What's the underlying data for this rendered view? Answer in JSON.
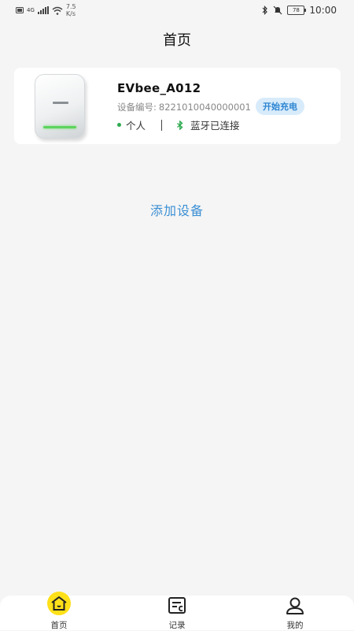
{
  "status_bar": {
    "signal_left": "4G",
    "speed_value": "7.5",
    "speed_unit": "K/s",
    "battery": "78",
    "time": "10:00"
  },
  "header": {
    "title": "首页"
  },
  "device": {
    "name": "EVbee_A012",
    "serial_label": "设备编号:",
    "serial": "8221010040000001",
    "charge_button": "开始充电",
    "owner": "个人",
    "bluetooth_status": "蓝牙已连接"
  },
  "add_device_label": "添加设备",
  "tabbar": {
    "tabs": [
      {
        "label": "首页",
        "icon": "home-icon",
        "active": true
      },
      {
        "label": "记录",
        "icon": "records-icon",
        "active": false
      },
      {
        "label": "我的",
        "icon": "profile-icon",
        "active": false
      }
    ]
  },
  "colors": {
    "accent": "#3b8fd4",
    "active_tab_highlight": "#ffe019",
    "online_dot": "#2daa4f"
  }
}
